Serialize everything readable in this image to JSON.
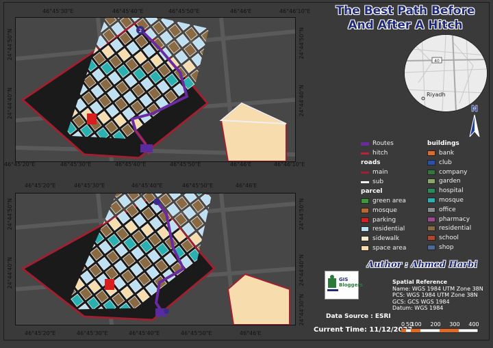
{
  "title": {
    "line1": "The Best Path Before",
    "line2": "And After A Hitch"
  },
  "top_map": {
    "x_labels_top": [
      "46°45'30\"E",
      "46°45'40\"E",
      "46°45'50\"E",
      "46°46'E",
      "46°46'10\"E"
    ],
    "x_labels_bottom": [
      "46°45'20\"E",
      "46°45'30\"E",
      "46°45'40\"E",
      "46°45'50\"E",
      "46°46'E",
      "46°46'10\"E"
    ],
    "y_labels_left": [
      "24°44'50\"N",
      "24°44'40\"N"
    ],
    "y_labels_right": [
      "24°44'50\"N",
      "24°44'40\"N"
    ],
    "marker_label": "2"
  },
  "bottom_map": {
    "x_labels_top": [
      "46°45'20\"E",
      "46°45'30\"E",
      "46°45'40\"E",
      "46°45'50\"E",
      "46°46'E"
    ],
    "x_labels_bottom": [
      "46°45'20\"E",
      "46°45'30\"E",
      "46°45'40\"E",
      "46°45'50\"E",
      "46°46'E"
    ],
    "y_labels_left": [
      "24°44'50\"N",
      "24°44'40\"N"
    ],
    "y_labels_right": [
      "24°44'50\"N",
      "24°44'40\"N",
      "24°44'30\"N"
    ]
  },
  "inset": {
    "city_label": "Riyadh",
    "road_shield": "40"
  },
  "north_arrow": {
    "label": "N"
  },
  "legend": {
    "routes_label": "Routes",
    "hitch_label": "hitch",
    "roads_header": "roads",
    "main_label": "main",
    "sub_label": "sub",
    "parcel_header": "parcel",
    "parcel_items": [
      {
        "label": "green area",
        "color": "#3a9a3a"
      },
      {
        "label": "mosque",
        "color": "#b96a2a"
      },
      {
        "label": "parking",
        "color": "#d81e1e"
      },
      {
        "label": "residential",
        "color": "#bde0f2"
      },
      {
        "label": "sidewalk",
        "color": "#f4e9c8"
      },
      {
        "label": "space area",
        "color": "#f7dcae"
      }
    ],
    "buildings_header": "buildings",
    "building_items": [
      {
        "label": "bank",
        "color": "#e06a28"
      },
      {
        "label": "club",
        "color": "#2850b0"
      },
      {
        "label": "company",
        "color": "#2f7a3a"
      },
      {
        "label": "garden",
        "color": "#8aa86a"
      },
      {
        "label": "hospital",
        "color": "#2a8a5a"
      },
      {
        "label": "mosque",
        "color": "#2ab0b0"
      },
      {
        "label": "office",
        "color": "#8c8c8c"
      },
      {
        "label": "pharmacy",
        "color": "#9a4a8a"
      },
      {
        "label": "residential",
        "color": "#8a6a42"
      },
      {
        "label": "school",
        "color": "#b8442a"
      },
      {
        "label": "shop",
        "color": "#4a6a9a"
      }
    ],
    "route_color": "#6a2aa0",
    "hitch_color": "#c0203a",
    "main_road_color": "#a02030",
    "sub_road_color": "#f0f0f0"
  },
  "author": "Author : Ahmed Harbi",
  "logo": {
    "line1": "GIS",
    "line2": "Bloggers"
  },
  "spatial_reference": {
    "heading": "Spatial Reference",
    "name": "Name: WGS 1984 UTM Zone 38N",
    "pcs": "PCS: WGS 1984 UTM Zone 38N",
    "gcs": "GCS: GCS WGS 1984",
    "datum": "Datum: WGS 1984"
  },
  "data_source": "Data Source : ESRI",
  "current_time": "Current Time: 11/12/2023",
  "scale_bar": {
    "labels": [
      "0",
      "50",
      "100",
      "200",
      "300",
      "400"
    ],
    "unit": "m"
  }
}
